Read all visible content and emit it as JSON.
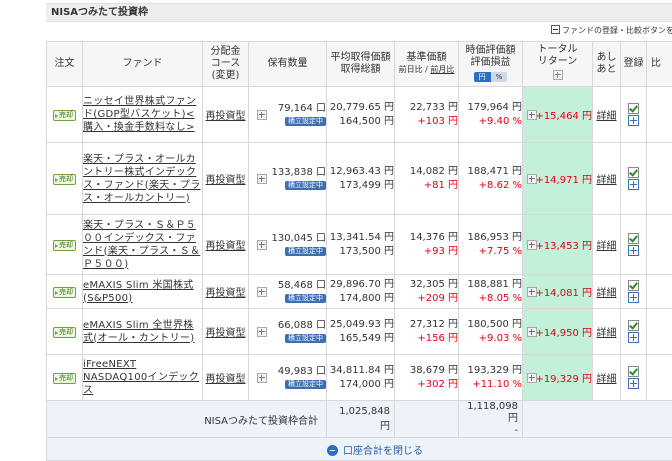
{
  "section": {
    "title": "NISAつみたて投資枠"
  },
  "toggle_label": "ファンドの登録・比較ボタンを",
  "headers": {
    "order": "注文",
    "fund": "ファンド",
    "course_1": "分配金",
    "course_2": "コース",
    "course_3": "(変更)",
    "qty": "保有数量",
    "avg_1": "平均取得価額",
    "avg_2": "取得総額",
    "base_1": "基準価額",
    "base_sub_a": "前日比",
    "base_sub_sep": "/",
    "base_sub_b": "前月比",
    "val_1": "時価評価額",
    "val_2": "評価損益",
    "unit_yen": "円",
    "unit_pct": "%",
    "ret_1": "トータル",
    "ret_2": "リターン",
    "ashi_1": "あし",
    "ashi_2": "あと",
    "reg": "登録",
    "cut": "比"
  },
  "sell_label": "売却",
  "course_label": "再投資型",
  "tsumitate_label": "積立設定中",
  "detail_label": "詳細",
  "rows": [
    {
      "fund": "ニッセイ世界株式ファンド(GDP型バスケット)<購入・換金手数料なし>",
      "qty": "79,164 口",
      "avg": "20,779.65 円",
      "total_cost": "164,500 円",
      "base": "22,733 円",
      "base_diff": "+103 円",
      "value": "179,964 円",
      "pl_pct": "+9.40 %",
      "ret": "+15,464 円"
    },
    {
      "fund": "楽天・プラス・オールカントリー株式インデックス・ファンド(楽天・プラス・オールカントリー)",
      "qty": "133,838 口",
      "avg": "12,963.43 円",
      "total_cost": "173,499 円",
      "base": "14,082 円",
      "base_diff": "+81 円",
      "value": "188,471 円",
      "pl_pct": "+8.62 %",
      "ret": "+14,971 円"
    },
    {
      "fund": "楽天・プラス・Ｓ＆Ｐ５００インデックス・ファンド(楽天・プラス・Ｓ＆Ｐ５００)",
      "qty": "130,045 口",
      "avg": "13,341.54 円",
      "total_cost": "173,500 円",
      "base": "14,376 円",
      "base_diff": "+93 円",
      "value": "186,953 円",
      "pl_pct": "+7.75 %",
      "ret": "+13,453 円"
    },
    {
      "fund": "eMAXIS Slim 米国株式(S&P500)",
      "qty": "58,468 口",
      "avg": "29,896.70 円",
      "total_cost": "174,800 円",
      "base": "32,305 円",
      "base_diff": "+209 円",
      "value": "188,881 円",
      "pl_pct": "+8.05 %",
      "ret": "+14,081 円"
    },
    {
      "fund": "eMAXIS Slim 全世界株式(オール・カントリー)",
      "qty": "66,088 口",
      "avg": "25,049.93 円",
      "total_cost": "165,549 円",
      "base": "27,312 円",
      "base_diff": "+156 円",
      "value": "180,500 円",
      "pl_pct": "+9.03 %",
      "ret": "+14,950 円"
    },
    {
      "fund": "iFreeNEXT NASDAQ100インデックス",
      "qty": "49,983 口",
      "avg": "34,811.84 円",
      "total_cost": "174,000 円",
      "base": "38,679 円",
      "base_diff": "+302 円",
      "value": "193,329 円",
      "pl_pct": "+11.10 %",
      "ret": "+19,329 円"
    }
  ],
  "total": {
    "label": "NISAつみたて投資枠合計",
    "cost": "1,025,848 円",
    "value": "1,118,098 円",
    "value_sub": "-"
  },
  "close_label": "口座合計を閉じる",
  "colors": {
    "return_bg": "#c2f0d8",
    "gain": "#e60012",
    "badge": "#3c6eb4",
    "link": "#2a5fa8"
  }
}
